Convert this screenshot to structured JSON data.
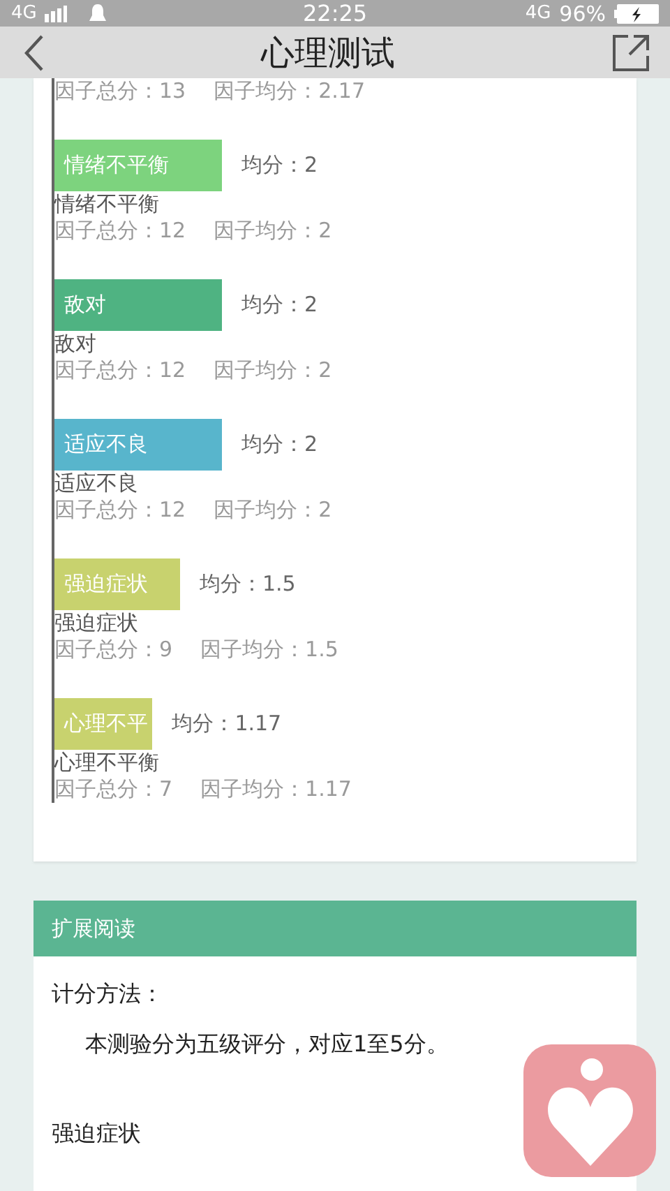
{
  "status_bar": {
    "network": "4G",
    "time": "22:25",
    "network_right": "4G",
    "battery": "96%"
  },
  "header": {
    "title": "心理测试"
  },
  "results": {
    "top_stats": {
      "total": "因子总分：13",
      "average": "因子均分：2.17"
    },
    "factors": [
      {
        "bar_label": "情绪不平衡",
        "avg": "均分：2",
        "color": "#7dd37e",
        "name": "情绪不平衡",
        "total": "因子总分：12",
        "average": "因子均分：2"
      },
      {
        "bar_label": "敌对",
        "avg": "均分：2",
        "color": "#4fb382",
        "name": "敌对",
        "total": "因子总分：12",
        "average": "因子均分：2"
      },
      {
        "bar_label": "适应不良",
        "avg": "均分：2",
        "color": "#58b5cc",
        "name": "适应不良",
        "total": "因子总分：12",
        "average": "因子均分：2"
      },
      {
        "bar_label": "强迫症状",
        "avg": "均分：1.5",
        "color": "#c8d26e",
        "name": "强迫症状",
        "total": "因子总分：9",
        "average": "因子均分：1.5"
      },
      {
        "bar_label": "心理不平",
        "avg": "均分：1.17",
        "color": "#c8d26e",
        "name": "心理不平衡",
        "total": "因子总分：7",
        "average": "因子均分：1.17"
      }
    ]
  },
  "reading": {
    "title": "扩展阅读",
    "paragraphs": [
      {
        "kind": "heading",
        "text": "计分方法："
      },
      {
        "kind": "indented",
        "text": "本测验分为五级评分，对应1至5分。"
      },
      {
        "kind": "heading",
        "text": "强迫症状"
      }
    ]
  }
}
